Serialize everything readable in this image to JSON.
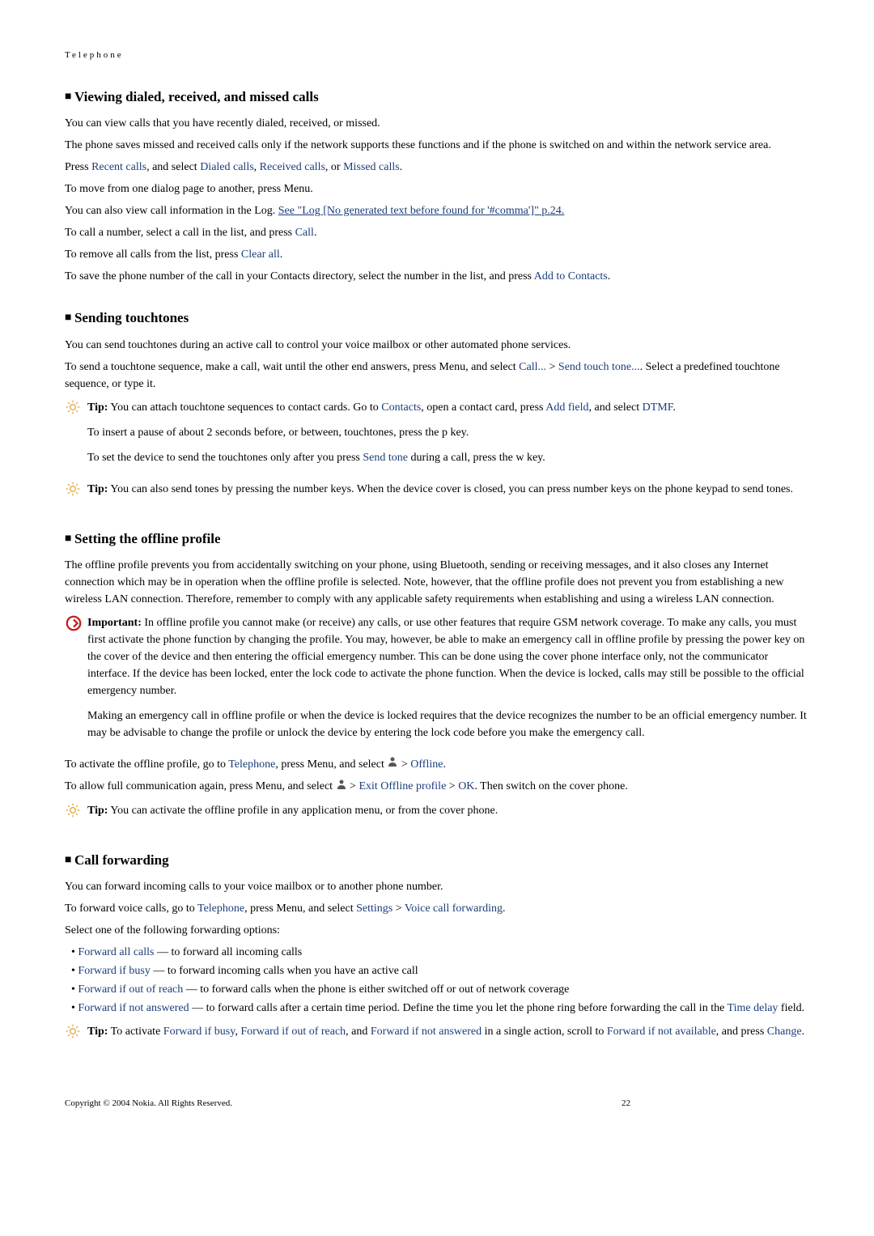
{
  "header": "Telephone",
  "sections": {
    "s1": {
      "title": "Viewing dialed, received, and missed calls",
      "p1": "You can view calls that you have recently dialed, received, or missed.",
      "p2": "The phone saves missed and received calls only if the network supports these functions and if the phone is switched on and within the network service area.",
      "p3_a": "Press ",
      "p3_b": "Recent calls",
      "p3_c": ", and select ",
      "p3_d": "Dialed calls",
      "p3_e": ", ",
      "p3_f": "Received calls",
      "p3_g": ", or ",
      "p3_h": "Missed calls",
      "p3_i": ".",
      "p4": "To move from one dialog page to another, press Menu.",
      "p5_a": "You can also view call information in the Log. ",
      "p5_b": "See \"Log [No generated text before found for '#comma']\" p.24.",
      "p6_a": "To call a number, select a call in the list, and press ",
      "p6_b": "Call",
      "p6_c": ".",
      "p7_a": "To remove all calls from the list, press ",
      "p7_b": "Clear all",
      "p7_c": ".",
      "p8_a": "To save the phone number of the call in your Contacts directory, select the number in the list, and press ",
      "p8_b": "Add to Contacts",
      "p8_c": "."
    },
    "s2": {
      "title": "Sending touchtones",
      "p1": "You can send touchtones during an active call to control your voice mailbox or other automated phone services.",
      "p2_a": "To send a touchtone sequence, make a call, wait until the other end answers, press Menu, and select ",
      "p2_b": "Call...",
      "p2_c": " > ",
      "p2_d": "Send touch tone...",
      "p2_e": ". Select a predefined touchtone sequence, or type it.",
      "tip1_a": "Tip:",
      "tip1_b": " You can attach touchtone sequences to contact cards. Go to ",
      "tip1_c": "Contacts",
      "tip1_d": ", open a contact card, press ",
      "tip1_e": "Add field",
      "tip1_f": ", and select ",
      "tip1_g": "DTMF",
      "tip1_h": ".",
      "tip1_p2": "To insert a pause of about 2 seconds before, or between, touchtones, press the p key.",
      "tip1_p3_a": "To set the device to send the touchtones only after you press ",
      "tip1_p3_b": "Send tone",
      "tip1_p3_c": " during a call, press the w key.",
      "tip2_a": "Tip:",
      "tip2_b": " You can also send tones by pressing the number keys. When the device cover is closed, you can press number keys on the phone keypad to send tones."
    },
    "s3": {
      "title": "Setting the offline profile",
      "p1": "The offline profile prevents you from accidentally switching on your phone, using Bluetooth, sending or receiving messages, and it also closes any Internet connection which may be in operation when the offline profile is selected. Note, however, that the offline profile does not prevent you from establishing a new wireless LAN connection. Therefore, remember to comply with any applicable safety requirements when establishing and using a wireless LAN connection.",
      "imp_a": "Important:",
      "imp_b": "  In offline profile you cannot make (or receive) any calls, or use other features that require GSM network coverage. To make any calls, you must first activate the phone function by changing the profile. You may, however, be able to make an emergency call in offline profile by pressing the power key on the cover of the device and then entering the official emergency number. This can be done using the cover phone interface only, not the communicator interface. If the device has been locked, enter the lock code to activate the phone function. When the device is locked, calls may still be possible to the official emergency number.",
      "imp_p2": "Making an emergency call in offline profile or when the device is locked requires that the device recognizes the number to be an official emergency number. It may be advisable to change the profile or unlock the device by entering the lock code before you make the emergency call.",
      "p2_a": "To activate the offline profile, go to ",
      "p2_b": "Telephone",
      "p2_c": ", press Menu, and select ",
      "p2_d": " > ",
      "p2_e": "Offline",
      "p2_f": ".",
      "p3_a": "To allow full communication again, press Menu, and select ",
      "p3_b": " > ",
      "p3_c": "Exit Offline profile",
      "p3_d": " > ",
      "p3_e": "OK",
      "p3_f": ". Then switch on the cover phone.",
      "tip3_a": "Tip:",
      "tip3_b": " You can activate the offline profile in any application menu, or from the cover phone."
    },
    "s4": {
      "title": "Call forwarding",
      "p1": "You can forward incoming calls to your voice mailbox or to another phone number.",
      "p2_a": "To forward voice calls, go to ",
      "p2_b": "Telephone",
      "p2_c": ", press Menu, and select ",
      "p2_d": "Settings",
      "p2_e": " > ",
      "p2_f": "Voice call forwarding",
      "p2_g": ".",
      "p3": "Select one of the following forwarding options:",
      "li1_a": "Forward all calls",
      "li1_b": "  — to forward all incoming calls",
      "li2_a": "Forward if busy",
      "li2_b": " — to forward incoming calls when you have an active call",
      "li3_a": "Forward if out of reach",
      "li3_b": " — to forward calls when the phone is either switched off or out of network coverage",
      "li4_a": "Forward if not answered",
      "li4_b": " — to forward calls after a certain time period. Define the time you let the phone ring before forwarding the call in the ",
      "li4_c": "Time delay",
      "li4_d": " field.",
      "tip4_a": "Tip:",
      "tip4_b": "  To activate ",
      "tip4_c": "Forward if busy",
      "tip4_d": ", ",
      "tip4_e": "Forward if out of reach",
      "tip4_f": ", and ",
      "tip4_g": "Forward if not answered",
      "tip4_h": " in a single action, scroll to ",
      "tip4_i": "Forward if not available",
      "tip4_j": ", and press ",
      "tip4_k": "Change",
      "tip4_l": "."
    }
  },
  "footer": {
    "copyright": "Copyright © 2004 Nokia. All Rights Reserved.",
    "page": "22"
  }
}
